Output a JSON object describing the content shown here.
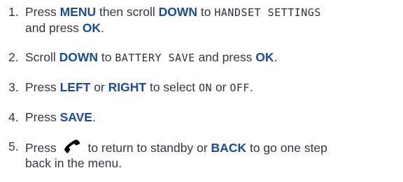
{
  "steps": [
    {
      "num": "1.",
      "parts": {
        "a": "Press ",
        "b": "MENU",
        "c": " then scroll ",
        "d": "DOWN",
        "e": " to ",
        "f": "HANDSET SETTINGS",
        "g": "and press ",
        "h": "OK",
        "i": "."
      }
    },
    {
      "num": "2.",
      "parts": {
        "a": "Scroll ",
        "b": "DOWN",
        "c": " to ",
        "d": "BATTERY SAVE",
        "e": " and press ",
        "f": "OK",
        "g": "."
      }
    },
    {
      "num": "3.",
      "parts": {
        "a": "Press ",
        "b": "LEFT",
        "c": " or ",
        "d": "RIGHT",
        "e": " to select ",
        "f": "ON",
        "g": " or ",
        "h": "OFF",
        "i": "."
      }
    },
    {
      "num": "4.",
      "parts": {
        "a": "Press ",
        "b": "SAVE",
        "c": "."
      }
    },
    {
      "num": "5.",
      "parts": {
        "a": "Press ",
        "icon": "end-call-icon",
        "b": " to return to standby or ",
        "c": "BACK",
        "d": " to go one step",
        "e": "back in the menu."
      }
    }
  ],
  "colors": {
    "text": "#333740",
    "keyword": "#1a4b9b",
    "icon": "#000000"
  }
}
